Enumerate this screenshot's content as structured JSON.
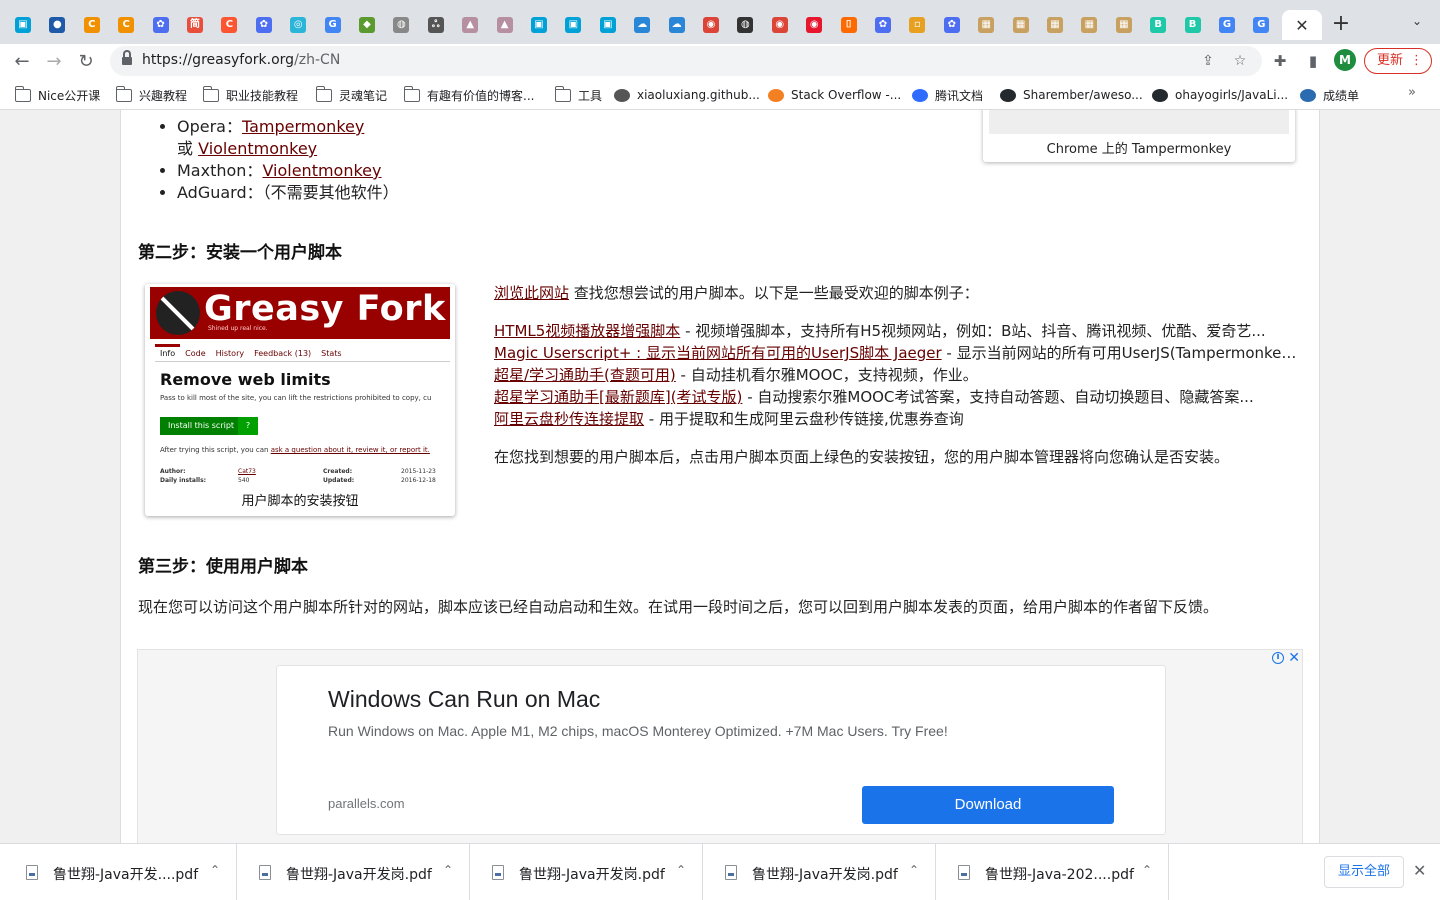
{
  "browser": {
    "tabs": [
      {
        "icon": "bilibili-icon",
        "glyph": "▣",
        "color": "#00a1d6"
      },
      {
        "icon": "circle-blue-icon",
        "glyph": "●",
        "color": "#1e5aa8"
      },
      {
        "icon": "c-orange-icon",
        "glyph": "C",
        "color": "#f29100"
      },
      {
        "icon": "c-orange-icon",
        "glyph": "C",
        "color": "#f29100"
      },
      {
        "icon": "baidu-paw-icon",
        "glyph": "✿",
        "color": "#4e6ef2"
      },
      {
        "icon": "jian-icon",
        "glyph": "简",
        "color": "#e94e3c"
      },
      {
        "icon": "csdn-icon",
        "glyph": "C",
        "color": "#fc5531"
      },
      {
        "icon": "baidu-paw-icon",
        "glyph": "✿",
        "color": "#4e6ef2"
      },
      {
        "icon": "cyan-swirl-icon",
        "glyph": "◎",
        "color": "#2bb5d8"
      },
      {
        "icon": "google-icon",
        "glyph": "G",
        "color": "#4285f4"
      },
      {
        "icon": "green-robot-icon",
        "glyph": "◆",
        "color": "#5a9a2f"
      },
      {
        "icon": "globe-icon",
        "glyph": "◍",
        "color": "#888888"
      },
      {
        "icon": "script-a-icon",
        "glyph": "ஃ",
        "color": "#555555"
      },
      {
        "icon": "triangle-icon",
        "glyph": "▲",
        "color": "#b68fa0"
      },
      {
        "icon": "triangle-icon",
        "glyph": "▲",
        "color": "#b68fa0"
      },
      {
        "icon": "bilibili-icon",
        "glyph": "▣",
        "color": "#00a1d6"
      },
      {
        "icon": "bilibili-icon",
        "glyph": "▣",
        "color": "#00a1d6"
      },
      {
        "icon": "bilibili-icon",
        "glyph": "▣",
        "color": "#00a1d6"
      },
      {
        "icon": "cloud-icon",
        "glyph": "☁",
        "color": "#2a87d8"
      },
      {
        "icon": "cloud-icon",
        "glyph": "☁",
        "color": "#2a87d8"
      },
      {
        "icon": "chrome-icon",
        "glyph": "◉",
        "color": "#db4437"
      },
      {
        "icon": "dark-globe-icon",
        "glyph": "◍",
        "color": "#333333"
      },
      {
        "icon": "chrome-icon",
        "glyph": "◉",
        "color": "#db4437"
      },
      {
        "icon": "weibo-icon",
        "glyph": "◉",
        "color": "#e6162d"
      },
      {
        "icon": "orange-bracket-icon",
        "glyph": "⌷",
        "color": "#ff6a00"
      },
      {
        "icon": "baidu-paw-icon",
        "glyph": "✿",
        "color": "#4e6ef2"
      },
      {
        "icon": "doc-icon",
        "glyph": "▫",
        "color": "#e8a020"
      },
      {
        "icon": "baidu-paw-icon",
        "glyph": "✿",
        "color": "#4e6ef2"
      },
      {
        "icon": "mooc-icon",
        "glyph": "▦",
        "color": "#c8a060"
      },
      {
        "icon": "mooc-icon",
        "glyph": "▦",
        "color": "#c8a060"
      },
      {
        "icon": "mooc-icon",
        "glyph": "▦",
        "color": "#c8a060"
      },
      {
        "icon": "mooc-icon",
        "glyph": "▦",
        "color": "#c8a060"
      },
      {
        "icon": "mooc-icon",
        "glyph": "▦",
        "color": "#c8a060"
      },
      {
        "icon": "b-green-icon",
        "glyph": "B",
        "color": "#1fc8a8"
      },
      {
        "icon": "b-green-icon",
        "glyph": "B",
        "color": "#1fc8a8"
      },
      {
        "icon": "google-icon",
        "glyph": "G",
        "color": "#4285f4"
      },
      {
        "icon": "google-icon",
        "glyph": "G",
        "color": "#4285f4"
      }
    ],
    "active_tab_close": "✕",
    "new_tab": "+",
    "tab_search": "⌄",
    "nav": {
      "back": "←",
      "forward": "→",
      "reload": "↻"
    },
    "url_host": "https://greasyfork.org",
    "url_path": "/zh-CN",
    "omnibox_icons": {
      "share": "⇪",
      "star": "☆"
    },
    "toolbar_icons": {
      "extensions": "✚",
      "sidepanel": "▮"
    },
    "profile_initial": "M",
    "update_label": "更新",
    "update_dots": "⋮",
    "bookmarks": [
      {
        "label": "Nice公开课",
        "icon": "folder"
      },
      {
        "label": "兴趣教程",
        "icon": "folder"
      },
      {
        "label": "职业技能教程",
        "icon": "folder"
      },
      {
        "label": "灵魂笔记",
        "icon": "folder"
      },
      {
        "label": "有趣有价值的博客...",
        "icon": "folder"
      },
      {
        "label": "工具",
        "icon": "folder"
      },
      {
        "label": "xiaoluxiang.github...",
        "icon": "globe"
      },
      {
        "label": "Stack Overflow -...",
        "icon": "stackoverflow"
      },
      {
        "label": "腾讯文档",
        "icon": "tencent-docs"
      },
      {
        "label": "Sharember/aweso...",
        "icon": "github"
      },
      {
        "label": "ohayogirls/JavaLi...",
        "icon": "github"
      },
      {
        "label": "成绩单",
        "icon": "grades"
      }
    ],
    "bookmarks_more": "»"
  },
  "page": {
    "browsers_list": [
      {
        "prefix": "Opera：",
        "link": "Tampermonkey"
      },
      {
        "prefix": "或 ",
        "link": "Violentmonkey",
        "sub": true
      },
      {
        "prefix": "Maxthon：",
        "link": "Violentmonkey"
      },
      {
        "prefix": "AdGuard：（不需要其他软件）",
        "link": ""
      }
    ],
    "tm_caption": "Chrome 上的 Tampermonkey",
    "step2_title": "第二步：安装一个用户脚本",
    "greasyfork_card": {
      "brand": "Greasy Fork",
      "tagline": "Shined up real nice.",
      "tabs": [
        "Info",
        "Code",
        "History",
        "Feedback (13)",
        "Stats"
      ],
      "script_title": "Remove web limits",
      "desc": "Pass to kill most of the site, you can lift the restrictions prohibited to copy, cu",
      "install_label": "Install this script",
      "install_q": "?",
      "after_text": "After trying this script, you can ",
      "after_link": "ask a question about it, review it, or report it.",
      "author_label": "Author:",
      "author_value": "Cat73",
      "daily_label": "Daily installs:",
      "daily_value": "540",
      "created_label": "Created:",
      "created_value": "2015-11-23",
      "updated_label": "Updated:",
      "updated_value": "2016-12-18",
      "caption": "用户脚本的安装按钮"
    },
    "browse_link": "浏览此网站",
    "browse_text": " 查找您想尝试的用户脚本。以下是一些最受欢迎的脚本例子：",
    "examples": [
      {
        "link": "HTML5视频播放器增强脚本",
        "text": " - 视频增强脚本，支持所有H5视频网站，例如：B站、抖音、腾讯视频、优酷、爱奇艺..."
      },
      {
        "link": "Magic Userscript+ : 显示当前网站所有可用的UserJS脚本 Jaeger",
        "text": " - 显示当前网站的所有可用UserJS(Tampermonkey)..."
      },
      {
        "link": "超星/学习通助手(查题可用)",
        "text": " - 自动挂机看尔雅MOOC，支持视频，作业。"
      },
      {
        "link": "超星学习通助手[最新题库](考试专版)",
        "text": " - 自动搜索尔雅MOOC考试答案，支持自动答题、自动切换题目、隐藏答案..."
      },
      {
        "link": "阿里云盘秒传连接提取",
        "text": " - 用于提取和生成阿里云盘秒传链接,优惠券查询"
      }
    ],
    "after_find": "在您找到想要的用户脚本后，点击用户脚本页面上绿色的安装按钮，您的用户脚本管理器将向您确认是否安装。",
    "step3_title": "第三步：使用用户脚本",
    "step3_text": "现在您可以访问这个用户脚本所针对的网站，脚本应该已经自动启动和生效。在试用一段时间之后，您可以回到用户脚本发表的页面，给用户脚本的作者留下反馈。",
    "ad": {
      "info": "i",
      "close": "✕",
      "title": "Windows Can Run on Mac",
      "body": "Run Windows on Mac. Apple M1, M2 chips, macOS Monterey Optimized. +7M Mac Users. Try Free!",
      "domain": "parallels.com",
      "cta": "Download"
    }
  },
  "downloads": {
    "items": [
      "鲁世翔-Java开发....pdf",
      "鲁世翔-Java开发岗.pdf",
      "鲁世翔-Java开发岗.pdf",
      "鲁世翔-Java开发岗.pdf",
      "鲁世翔-Java-202....pdf"
    ],
    "chevron": "⌃",
    "show_all": "显示全部",
    "close": "✕"
  }
}
